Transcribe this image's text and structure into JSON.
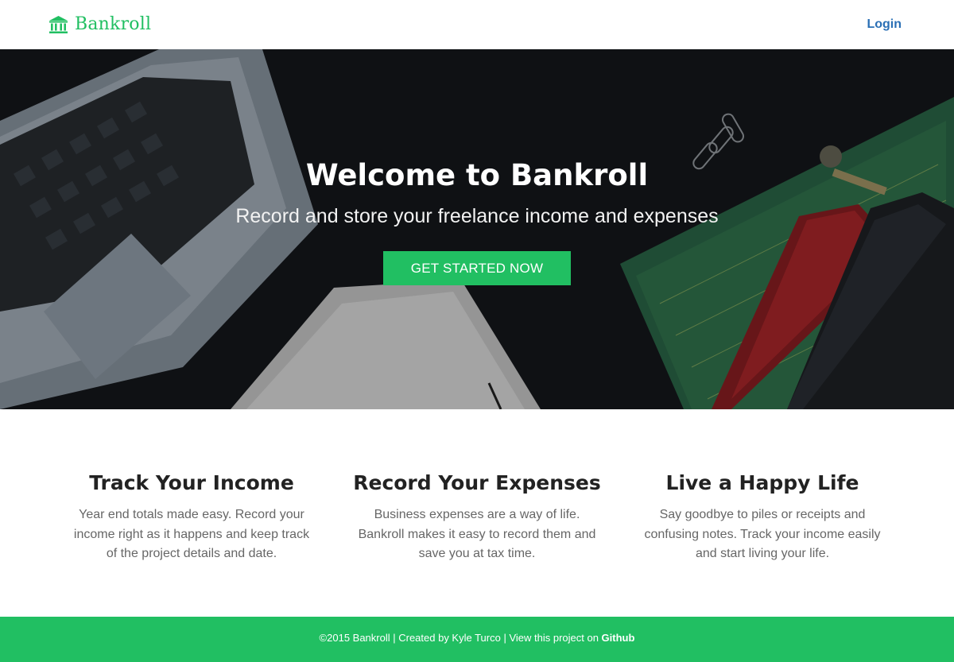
{
  "header": {
    "brand": "Bankroll",
    "brand_icon": "bank-icon",
    "login_label": "Login"
  },
  "hero": {
    "title": "Welcome to Bankroll",
    "subtitle": "Record and store your freelance income and expenses",
    "cta_label": "GET STARTED NOW"
  },
  "features": [
    {
      "title": "Track Your Income",
      "text": "Year end totals made easy. Record your income right as it happens and keep track of the project details and date."
    },
    {
      "title": "Record Your Expenses",
      "text": "Business expenses are a way of life. Bankroll makes it easy to record them and save you at tax time."
    },
    {
      "title": "Live a Happy Life",
      "text": "Say goodbye to piles or receipts and confusing notes. Track your income easily and start living your life."
    }
  ],
  "footer": {
    "text": "©2015 Bankroll | Created by Kyle Turco | View this project on ",
    "link_label": "Github"
  },
  "colors": {
    "brand_green": "#21bf62",
    "login_blue": "#2a6fb5",
    "hero_dark": "#15171b"
  }
}
